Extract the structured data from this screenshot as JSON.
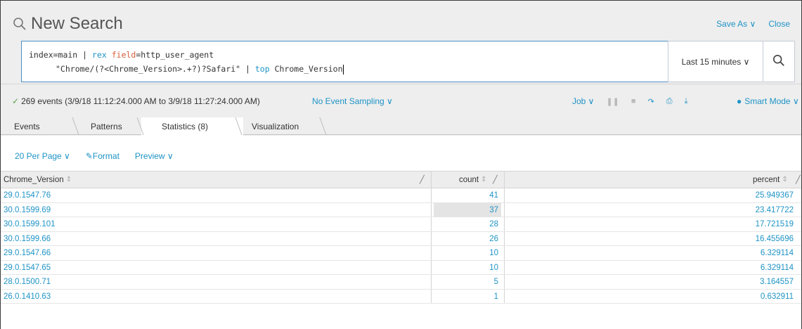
{
  "header": {
    "title": "New Search",
    "save_as": "Save As ∨",
    "close": "Close"
  },
  "search": {
    "line1_a": "index=main | ",
    "line1_rex": "rex",
    "line1_space": " ",
    "line1_field": "field",
    "line1_b": "=http_user_agent",
    "line2_a": "\"Chrome/(?<Chrome_Version>.+?)?Safari\" | ",
    "line2_top": "top",
    "line2_b": " Chrome_Version",
    "time_range": "Last 15 minutes ∨"
  },
  "status": {
    "events": "269 events (3/9/18 11:12:24.000 AM to 3/9/18 11:27:24.000 AM)",
    "sampling": "No Event Sampling ∨",
    "job": "Job ∨",
    "mode": "Smart Mode ∨"
  },
  "tabs": [
    {
      "label": "Events"
    },
    {
      "label": "Patterns"
    },
    {
      "label": "Statistics (8)"
    },
    {
      "label": "Visualization"
    }
  ],
  "toolbar": {
    "per_page": "20 Per Page ∨",
    "format": "Format",
    "preview": "Preview ∨"
  },
  "table": {
    "columns": [
      "Chrome_Version",
      "count",
      "percent"
    ],
    "rows": [
      {
        "version": "29.0.1547.76",
        "count": "41",
        "percent": "25.949367"
      },
      {
        "version": "30.0.1599.69",
        "count": "37",
        "percent": "23.417722"
      },
      {
        "version": "30.0.1599.101",
        "count": "28",
        "percent": "17.721519"
      },
      {
        "version": "30.0.1599.66",
        "count": "26",
        "percent": "16.455696"
      },
      {
        "version": "29.0.1547.66",
        "count": "10",
        "percent": "6.329114"
      },
      {
        "version": "29.0.1547.65",
        "count": "10",
        "percent": "6.329114"
      },
      {
        "version": "28.0.1500.71",
        "count": "5",
        "percent": "3.164557"
      },
      {
        "version": "26.0.1410.63",
        "count": "1",
        "percent": "0.632911"
      }
    ]
  },
  "colors": {
    "link": "#1e93c6",
    "success": "#5ea34a",
    "header_bg": "#eeeeee"
  }
}
